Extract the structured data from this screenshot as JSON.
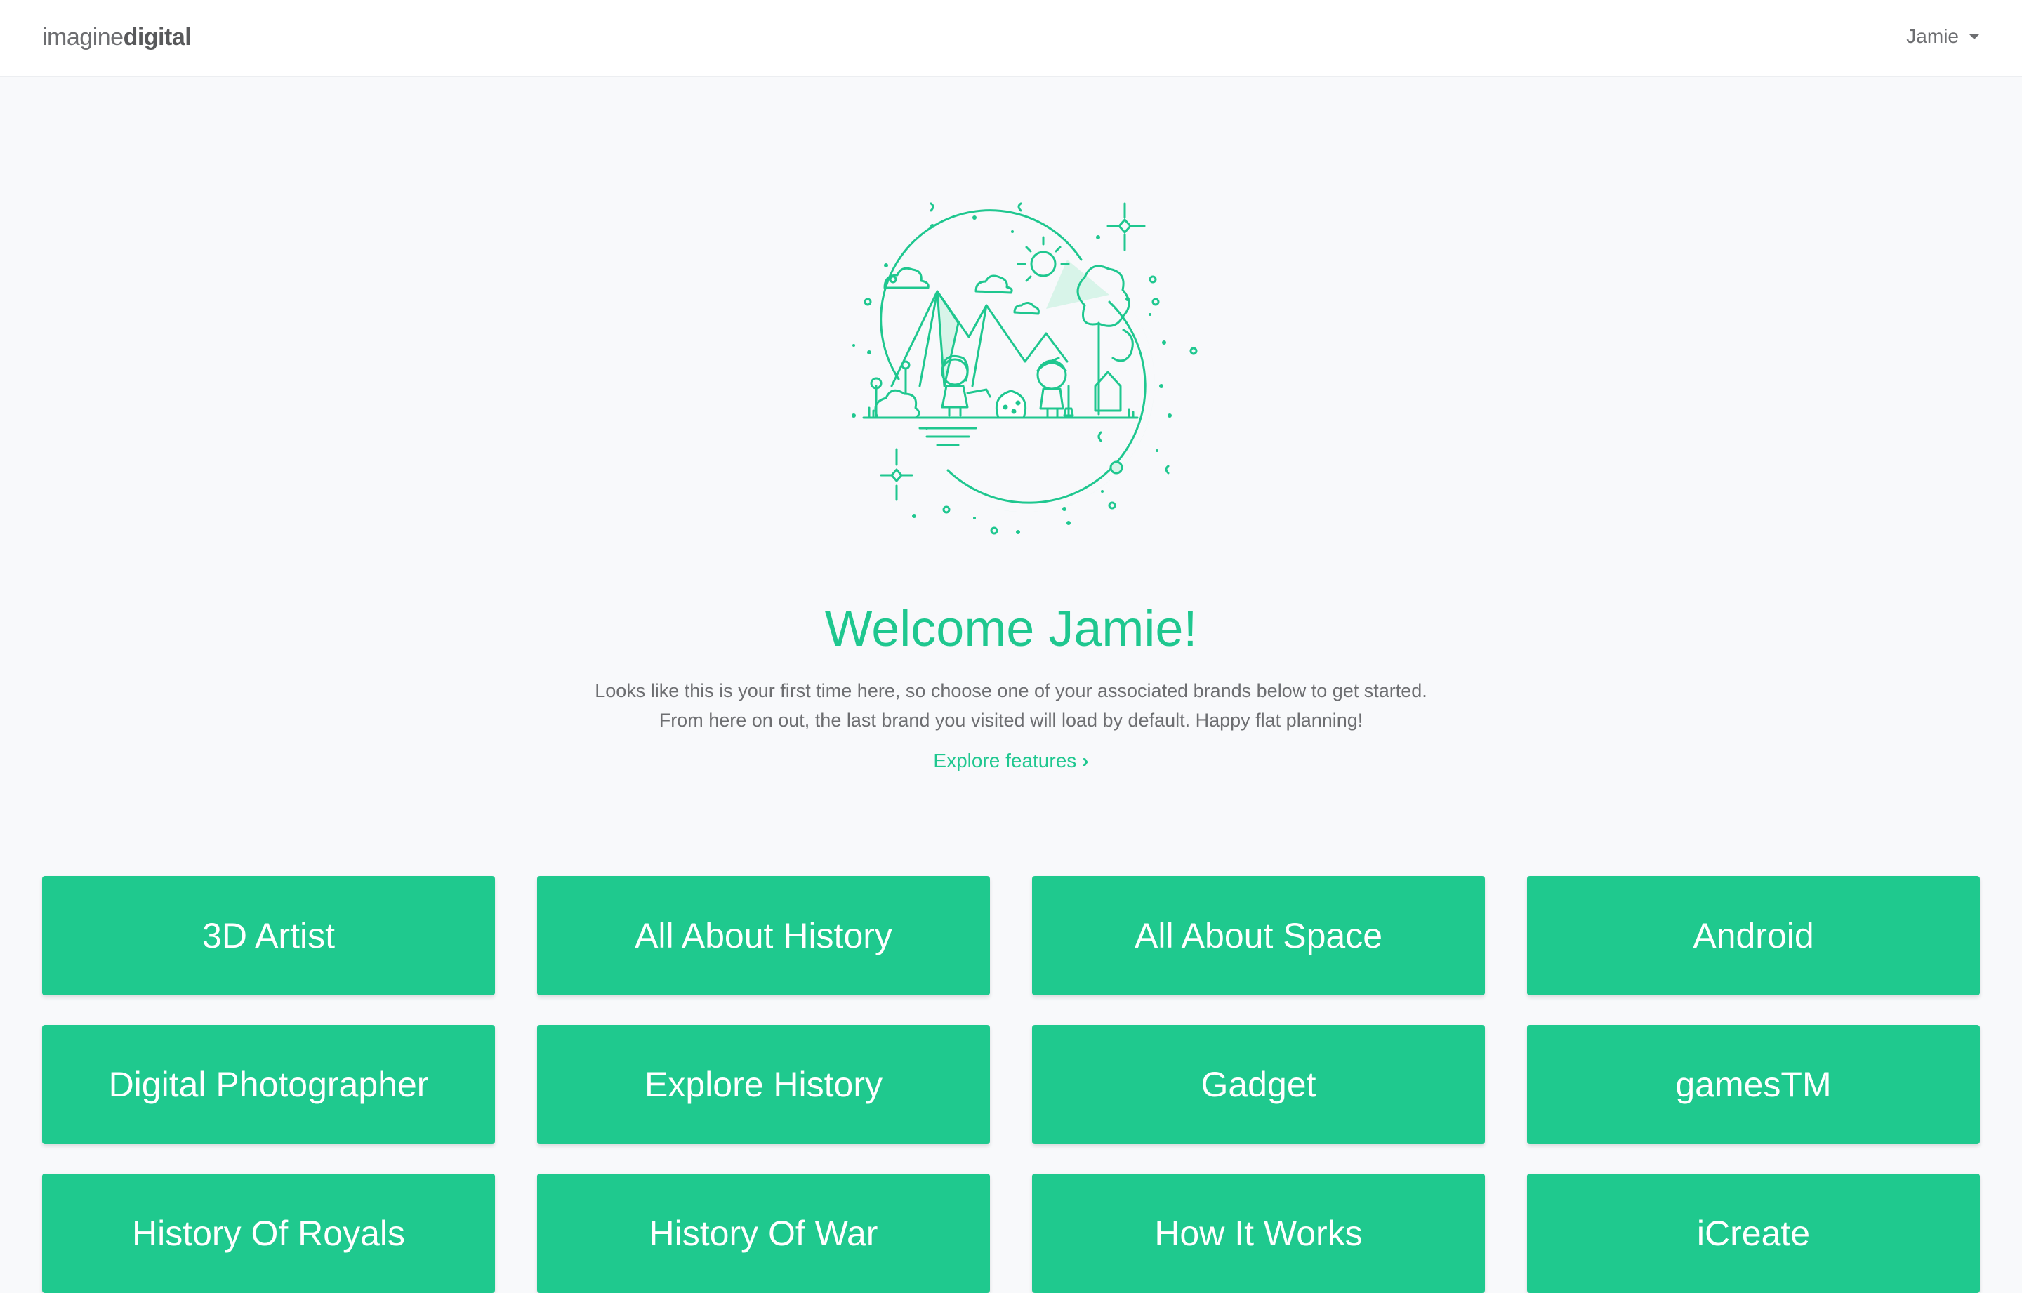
{
  "header": {
    "logo_light": "imagine",
    "logo_bold": "digital",
    "user_name": "Jamie"
  },
  "welcome": {
    "title": "Welcome Jamie!",
    "line1": "Looks like this is your first time here, so choose one of your associated brands below to get started.",
    "line2": "From here on out, the last brand you visited will load by default. Happy flat planning!",
    "explore_label": "Explore features",
    "explore_icon": "chevron-right-icon"
  },
  "brands": [
    "3D Artist",
    "All About History",
    "All About Space",
    "Android",
    "Digital Photographer",
    "Explore History",
    "Gadget",
    "gamesTM",
    "History Of Royals",
    "History Of War",
    "How It Works",
    "iCreate"
  ],
  "colors": {
    "accent": "#1fc78f",
    "tile": "#1fc98e",
    "background": "#f8f9fb",
    "text": "#6d6e71"
  }
}
